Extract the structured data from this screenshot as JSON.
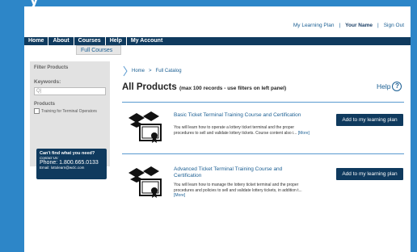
{
  "banner": {
    "title": "y"
  },
  "user_nav": {
    "learning_plan": "My Learning Plan",
    "sep1": "|",
    "name": "Your Name",
    "sep2": "|",
    "sign_out": "Sign Out"
  },
  "nav": {
    "items": [
      "Home",
      "About",
      "Courses",
      "Help",
      "My Account"
    ],
    "dropdown_item": "Full Courses"
  },
  "sidebar": {
    "title": "Filter Products",
    "keywords_label": "Keywords:",
    "search_value": "Q|",
    "products_label": "Products",
    "checkbox_label": "Training for Terminal Operators",
    "help": {
      "title": "Can't find what you need?",
      "contact": "Contact Us:",
      "phone": "Phone: 1.800.665.0133",
      "email": "Email: lottolearn@wclc.com"
    }
  },
  "breadcrumb": {
    "home": "Home",
    "sep": ">",
    "current": "Full Catalog"
  },
  "heading": {
    "title": "All Products",
    "subtitle": "(max 100 records - use filters on left panel)"
  },
  "help_link": {
    "label": "Help"
  },
  "products": [
    {
      "title": "Basic Ticket Terminal Training Course and Certification",
      "desc": "You will learn how to operate a lottery ticket terminal and the proper procedures to sell and validate lottery tickets.  Course content also i...",
      "more": "[More]",
      "button": "Add to my learning plan"
    },
    {
      "title": "Advanced Ticket Terminal Training Course and Certification",
      "desc": "You will learn how to manage the lottery ticket terminal and the proper procedures and policies to sell and validate lottery tickets, in addition t...",
      "more": "[More]",
      "button": "Add to my learning plan"
    }
  ]
}
